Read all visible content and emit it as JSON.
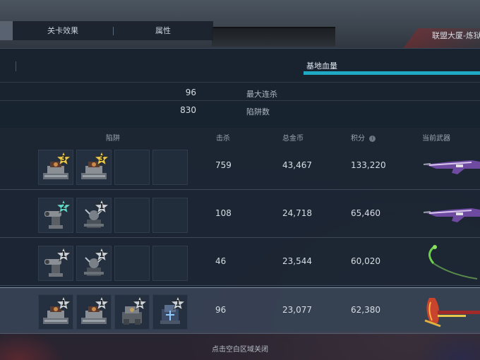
{
  "tabs": [
    {
      "label": "关卡效果"
    },
    {
      "label": "属性"
    }
  ],
  "location_text": "联盟大厦-炼狱",
  "summary": {
    "hp_label": "基地血量",
    "hp_fraction": 1.0,
    "max_streak_value": "96",
    "max_streak_label": "最大连杀",
    "trap_count_value": "830",
    "trap_count_label": "陷阱数"
  },
  "columns": {
    "traps": "陷阱",
    "kills": "击杀",
    "gold": "总金币",
    "score": "积分",
    "score_info_icon": "i",
    "weapon": "当前武器"
  },
  "players": [
    {
      "kills": "759",
      "gold": "43,467",
      "score": "133,220",
      "weapon_icon": "purple-rifle-icon",
      "traps": [
        {
          "icon": "turret-trap-icon",
          "level": "3",
          "star_color": "#e8c64a"
        },
        {
          "icon": "turret-trap-icon",
          "level": "3",
          "star_color": "#e8c64a"
        },
        {
          "icon": "empty"
        },
        {
          "icon": "empty"
        }
      ]
    },
    {
      "kills": "108",
      "gold": "24,718",
      "score": "65,460",
      "weapon_icon": "purple-rifle-icon",
      "traps": [
        {
          "icon": "cannon-trap-icon",
          "level": "2",
          "star_color": "#5fd3c9"
        },
        {
          "icon": "tesla-trap-icon",
          "level": "1",
          "star_color": "#c9d1da"
        },
        {
          "icon": "empty"
        },
        {
          "icon": "empty"
        }
      ]
    },
    {
      "kills": "46",
      "gold": "23,544",
      "score": "60,020",
      "weapon_icon": "green-scythe-icon",
      "traps": [
        {
          "icon": "cannon-trap-icon",
          "level": "1",
          "star_color": "#c9d1da"
        },
        {
          "icon": "tesla-trap-icon",
          "level": "1",
          "star_color": "#c9d1da"
        },
        {
          "icon": "empty"
        },
        {
          "icon": "empty"
        }
      ]
    },
    {
      "kills": "96",
      "gold": "23,077",
      "score": "62,380",
      "weapon_icon": "red-blade-icon",
      "highlight": true,
      "traps": [
        {
          "icon": "turret-trap-icon",
          "level": "1",
          "star_color": "#c9d1da"
        },
        {
          "icon": "turret-trap-icon",
          "level": "1",
          "star_color": "#c9d1da"
        },
        {
          "icon": "mech-trap-icon",
          "level": "1",
          "star_color": "#c9d1da"
        },
        {
          "icon": "ice-trap-icon",
          "level": "1",
          "star_color": "#c9d1da"
        }
      ]
    }
  ],
  "close_hint": "点击空白区域关闭",
  "colors": {
    "accent": "#1fa9c4",
    "panel": "#1c2634",
    "gold_star": "#e8c64a",
    "teal_star": "#5fd3c9",
    "silver_star": "#c9d1da"
  }
}
